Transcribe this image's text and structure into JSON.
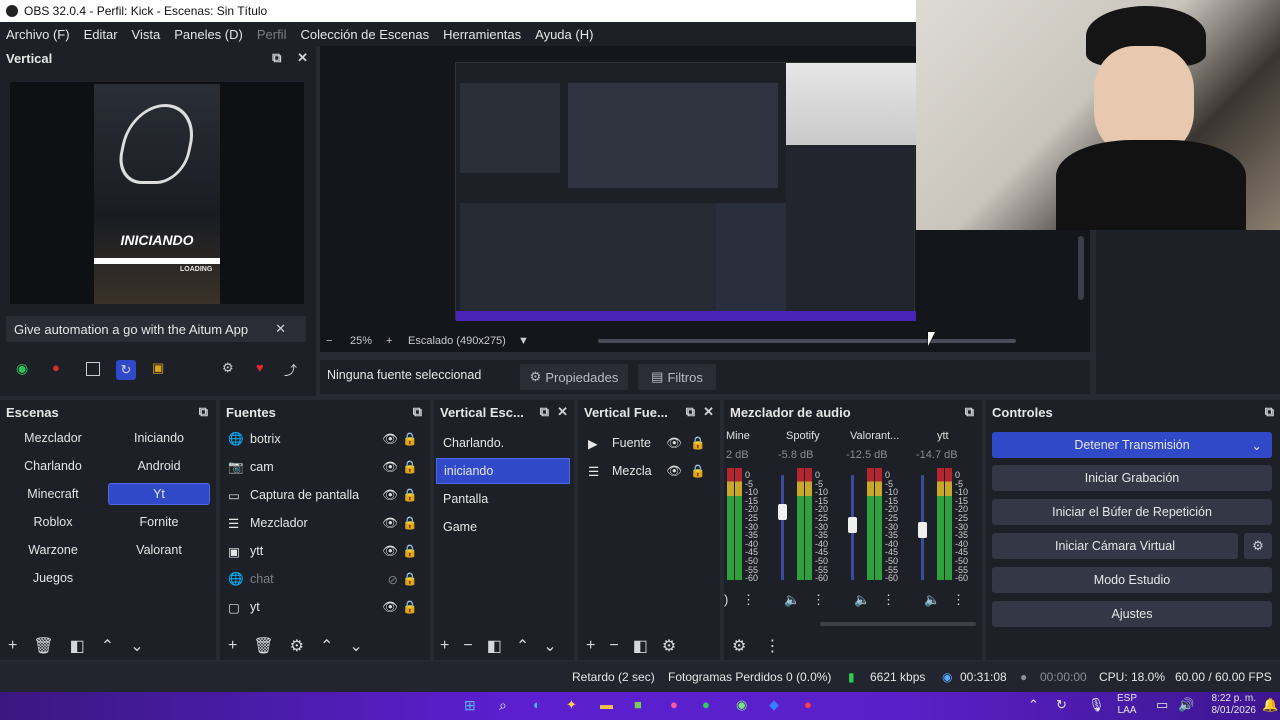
{
  "window": {
    "title": "OBS 32.0.4 - Perfil: Kick - Escenas: Sin Título"
  },
  "menu": [
    "Archivo (F)",
    "Editar",
    "Vista",
    "Paneles (D)",
    "Perfil",
    "Colección de Escenas",
    "Herramientas",
    "Ayuda (H)"
  ],
  "vertical_panel": {
    "title": "Vertical",
    "preview_text": "INICIANDO",
    "loading_text": "LOADING"
  },
  "aitum_bar": {
    "text": "Give automation a go with the Aitum App"
  },
  "preview_bar": {
    "zoom": "25%",
    "scale_mode": "Escalado (490x275)"
  },
  "source_bar": {
    "no_source": "Ninguna fuente seleccionad",
    "properties": "Propiedades",
    "filters": "Filtros"
  },
  "scenes": {
    "title": "Escenas",
    "items": [
      "Mezclador",
      "Iniciando",
      "Charlando",
      "Android",
      "Minecraft",
      "Yt",
      "Roblox",
      "Fornite",
      "Warzone",
      "Valorant",
      "Juegos"
    ],
    "active": "Yt"
  },
  "sources": {
    "title": "Fuentes",
    "items": [
      {
        "name": "botrix",
        "icon": "globe-icon"
      },
      {
        "name": "cam",
        "icon": "camera-icon"
      },
      {
        "name": "Captura de pantalla",
        "icon": "monitor-icon"
      },
      {
        "name": "Mezclador",
        "icon": "list-icon"
      },
      {
        "name": "ytt",
        "icon": "text-icon"
      },
      {
        "name": "chat",
        "icon": "globe-icon",
        "hidden": true
      },
      {
        "name": "yt",
        "icon": "window-icon"
      }
    ]
  },
  "vertical_scenes": {
    "title": "Vertical Esc...",
    "items": [
      "Charlando.",
      "iniciando",
      "Pantalla",
      "Game"
    ],
    "active": "iniciando"
  },
  "vertical_sources": {
    "title": "Vertical Fue...",
    "items": [
      {
        "name": "Fuente",
        "icon": "play-icon"
      },
      {
        "name": "Mezcla",
        "icon": "list-icon"
      }
    ]
  },
  "mixer": {
    "title": "Mezclador de audio",
    "channels": [
      {
        "name": "Mine",
        "db": "2 dB",
        "level": 0.72
      },
      {
        "name": "Spotify",
        "db": "-5.8 dB",
        "level": 0.72
      },
      {
        "name": "Valorant...",
        "db": "-12.5 dB",
        "level": 0.6
      },
      {
        "name": "ytt",
        "db": "-14.7 dB",
        "level": 0.55
      }
    ],
    "scale": [
      "0",
      "-5",
      "-10",
      "-15",
      "-20",
      "-25",
      "-30",
      "-35",
      "-40",
      "-45",
      "-50",
      "-55",
      "-60"
    ]
  },
  "controls": {
    "title": "Controles",
    "buttons": [
      "Detener Transmisión",
      "Iniciar Grabación",
      "Iniciar el Búfer de Repetición",
      "Iniciar Cámara Virtual",
      "Modo Estudio",
      "Ajustes"
    ]
  },
  "status": {
    "delay": "Retardo (2 sec)",
    "dropped": "Fotogramas Perdidos 0 (0.0%)",
    "bitrate": "6621 kbps",
    "stream_time": "00:31:08",
    "rec_time": "00:00:00",
    "cpu": "CPU: 18.0%",
    "fps": "60.00 / 60.00 FPS"
  },
  "taskbar": {
    "lang": "ESP",
    "lang2": "LAA",
    "time": "8:22 p. m.",
    "date": "8/01/2026"
  },
  "colors": {
    "accent": "#2f49c8",
    "panel": "#1e2027",
    "background": "#272a33"
  }
}
